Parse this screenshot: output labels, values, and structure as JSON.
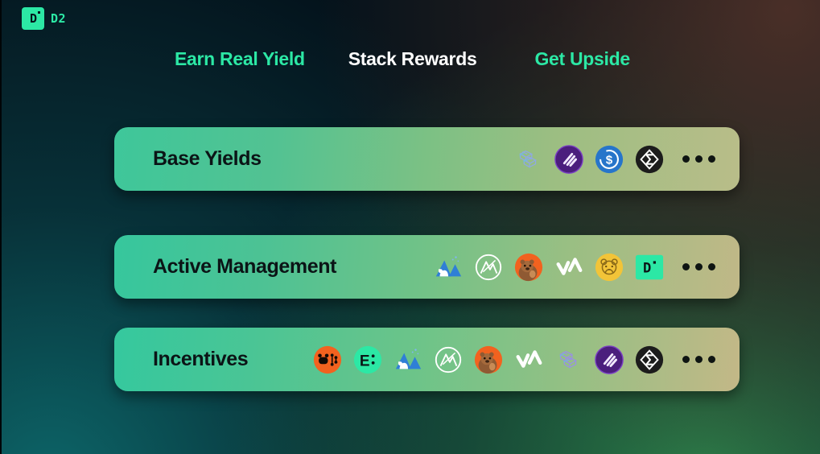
{
  "brand": {
    "logo_glyph": "D",
    "logo_text": "D2",
    "logo_color": "#2ce8a5",
    "logo_icon_name": "d2-logo-icon"
  },
  "headings": [
    {
      "label": "Earn Real Yield",
      "color": "#2ce8a5"
    },
    {
      "label": "Stack Rewards",
      "color": "#ffffff"
    },
    {
      "label": "Get Upside",
      "color": "#2ce8a5"
    }
  ],
  "rows": [
    {
      "label": "Base Yields",
      "gradient_start": "#3ec79a",
      "gradient_end": "#b9bd89",
      "icons": [
        {
          "name": "pendle-wireframe-icon"
        },
        {
          "name": "purple-stripes-token-icon"
        },
        {
          "name": "usdc-dollar-coin-icon"
        },
        {
          "name": "sigma-diamond-token-icon"
        }
      ],
      "overflow_label": "..."
    },
    {
      "label": "Active Management",
      "gradient_start": "#36c79d",
      "gradient_end": "#c0b887",
      "icons": [
        {
          "name": "mountain-bear-icon"
        },
        {
          "name": "mountain-circle-outline-icon"
        },
        {
          "name": "beaver-orange-icon"
        },
        {
          "name": "vertex-peak-icon"
        },
        {
          "name": "hamster-yellow-coin-icon"
        },
        {
          "name": "d2-square-icon"
        }
      ],
      "overflow_label": "..."
    },
    {
      "label": "Incentives",
      "gradient_start": "#35c89e",
      "gradient_end": "#c3b887",
      "icons": [
        {
          "name": "orange-bear-chain-icon"
        },
        {
          "name": "ethena-e-coin-icon"
        },
        {
          "name": "mountain-bear-icon"
        },
        {
          "name": "mountain-circle-outline-icon"
        },
        {
          "name": "beaver-orange-icon"
        },
        {
          "name": "vertex-peak-icon"
        },
        {
          "name": "pendle-wireframe-icon"
        },
        {
          "name": "purple-stripes-token-icon"
        },
        {
          "name": "sigma-diamond-token-icon"
        }
      ],
      "overflow_label": "..."
    }
  ]
}
